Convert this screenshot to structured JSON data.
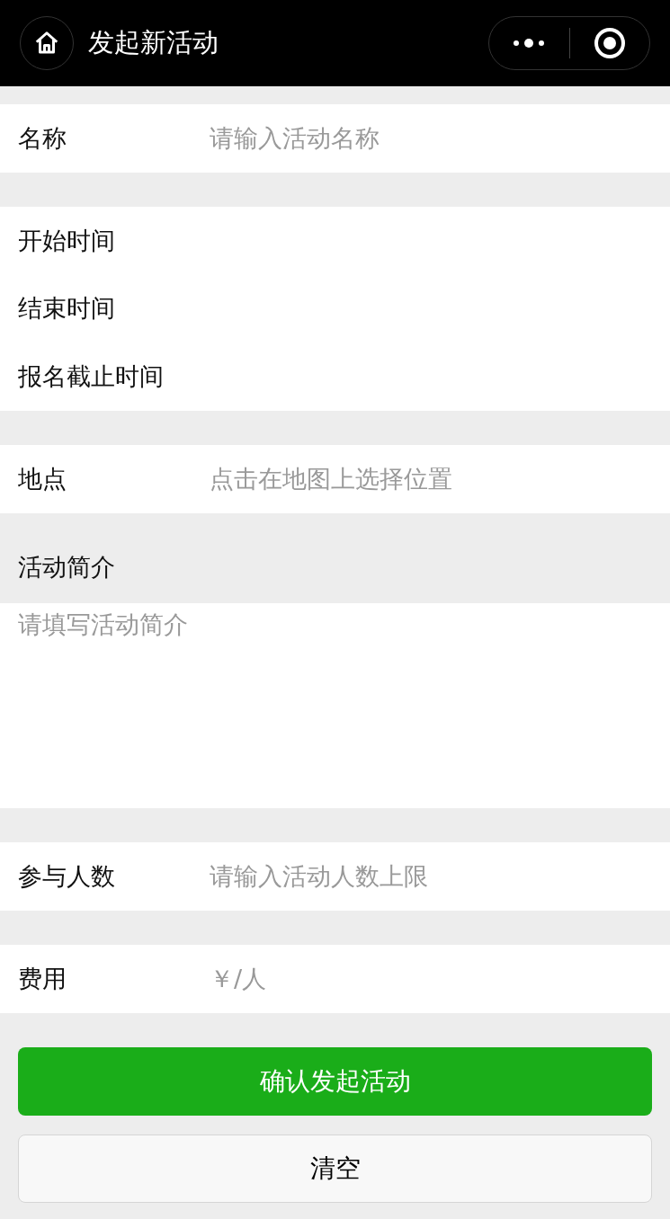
{
  "nav": {
    "title": "发起新活动"
  },
  "name_row": {
    "label": "名称",
    "placeholder": "请输入活动名称"
  },
  "time_rows": [
    {
      "label": "开始时间"
    },
    {
      "label": "结束时间"
    },
    {
      "label": "报名截止时间"
    }
  ],
  "location_row": {
    "label": "地点",
    "placeholder": "点击在地图上选择位置"
  },
  "intro": {
    "label": "活动简介",
    "placeholder": "请填写活动简介"
  },
  "count_row": {
    "label": "参与人数",
    "placeholder": "请输入活动人数上限"
  },
  "fee_row": {
    "label": "费用",
    "placeholder": "￥/人"
  },
  "buttons": [
    {
      "label": "确认发起活动",
      "kind": "primary"
    },
    {
      "label": "清空",
      "kind": "default"
    }
  ]
}
